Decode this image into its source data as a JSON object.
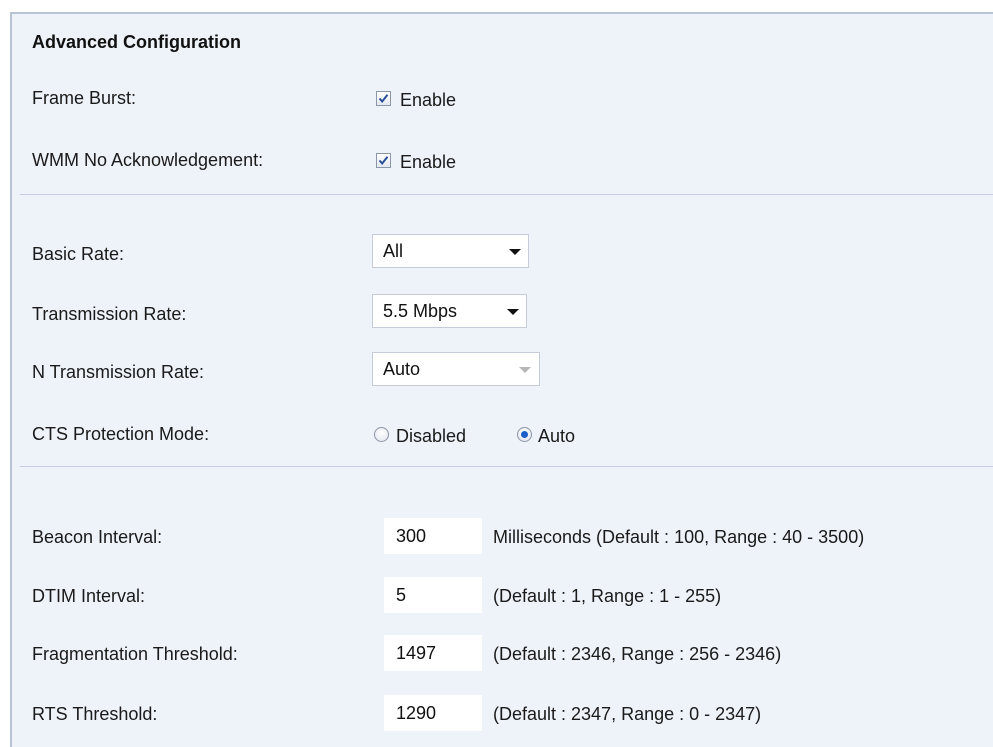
{
  "section_title": "Advanced Configuration",
  "frame_burst": {
    "label": "Frame Burst:",
    "checked": true,
    "option_label": "Enable"
  },
  "wmm_no_ack": {
    "label": "WMM No Acknowledgement:",
    "checked": true,
    "option_label": "Enable"
  },
  "basic_rate": {
    "label": "Basic Rate:",
    "value": "All"
  },
  "transmission_rate": {
    "label": "Transmission Rate:",
    "value": "5.5 Mbps"
  },
  "n_transmission_rate": {
    "label": "N Transmission Rate:",
    "value": "Auto",
    "disabled": true
  },
  "cts_protection": {
    "label": "CTS Protection Mode:",
    "options": [
      "Disabled",
      "Auto"
    ],
    "selected": "Auto"
  },
  "beacon_interval": {
    "label": "Beacon Interval:",
    "value": "300",
    "hint": "Milliseconds (Default : 100, Range : 40 - 3500)"
  },
  "dtim_interval": {
    "label": "DTIM Interval:",
    "value": "5",
    "hint": "(Default : 1, Range : 1 - 255)"
  },
  "fragmentation_threshold": {
    "label": "Fragmentation Threshold:",
    "value": "1497",
    "hint": "(Default : 2346, Range : 256 - 2346)"
  },
  "rts_threshold": {
    "label": "RTS Threshold:",
    "value": "1290",
    "hint": "(Default : 2347, Range : 0 - 2347)"
  },
  "colors": {
    "panel_bg": "#eef2f9",
    "divider": "#c5cbe0",
    "radio_accent": "#1d5fc8"
  }
}
